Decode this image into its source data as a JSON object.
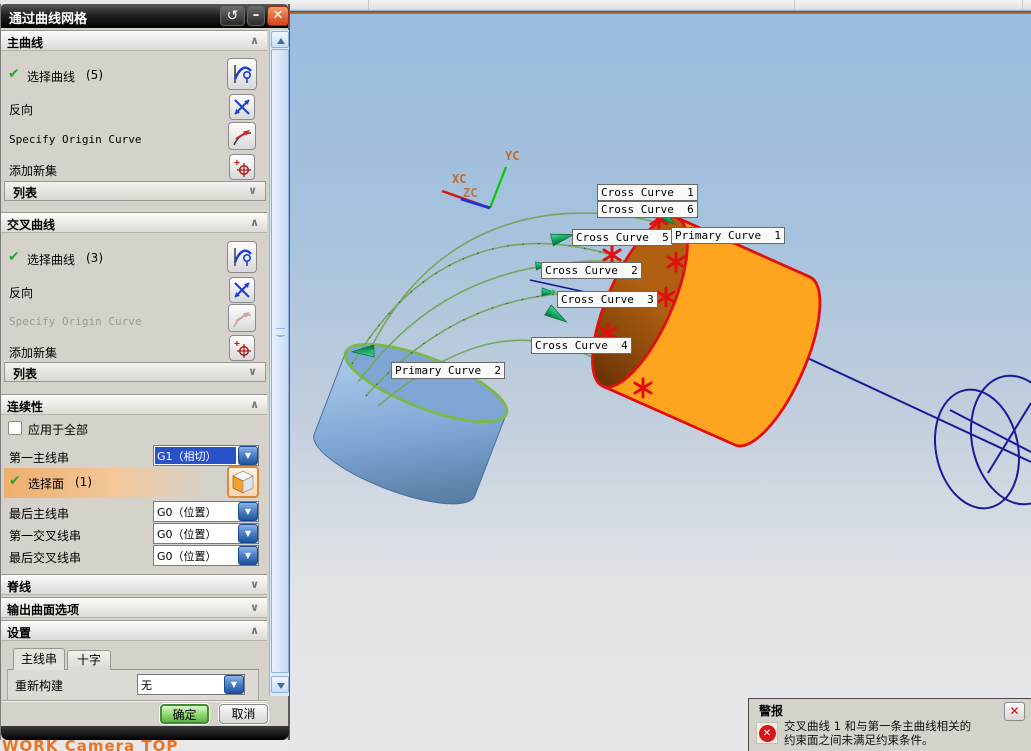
{
  "icons": {
    "check": "✔",
    "collapse": "∧",
    "expand": "∨",
    "dropdown": "▼",
    "reset": "↺",
    "minimize": "–",
    "close": "✕",
    "alert_error": "✕"
  },
  "dialog": {
    "title": "通过曲线网格",
    "primary": {
      "header": "主曲线",
      "select": "选择曲线",
      "count": "(5)",
      "reverse": "反向",
      "origin": "Specify Origin Curve",
      "add_set": "添加新集",
      "list": "列表"
    },
    "cross": {
      "header": "交叉曲线",
      "select": "选择曲线",
      "count": "(3)",
      "reverse": "反向",
      "origin": "Specify Origin Curve",
      "add_set": "添加新集",
      "list": "列表"
    },
    "continuity": {
      "header": "连续性",
      "apply_all": "应用于全部",
      "first_primary": "第一主线串",
      "first_primary_value": "G1（相切）",
      "select_face": "选择面",
      "face_count": "(1)",
      "last_primary": "最后主线串",
      "last_primary_value": "G0（位置）",
      "first_cross": "第一交叉线串",
      "first_cross_value": "G0（位置）",
      "last_cross": "最后交叉线串",
      "last_cross_value": "G0（位置）"
    },
    "spine_header": "脊线",
    "output_header": "输出曲面选项",
    "settings": {
      "header": "设置",
      "tab_primary": "主线串",
      "tab_cross": "十字",
      "rebuild": "重新构建",
      "rebuild_value": "无"
    },
    "ok": "确定",
    "cancel": "取消"
  },
  "viewport": {
    "axis": {
      "xc": "XC",
      "yc": "YC",
      "zc": "ZC"
    },
    "labels": {
      "cross1": "Cross Curve  1",
      "cross6": "Cross Curve  6",
      "cross5": "Cross Curve  5",
      "primary1": "Primary Curve  1",
      "cross2": "Cross Curve  2",
      "cross3": "Cross Curve  3",
      "cross4": "Cross Curve  4",
      "primary2": "Primary Curve  2"
    },
    "status_text": "WORK Camera TOP",
    "colors": {
      "curve_green": "#74a85c",
      "highlight_red": "#e01010",
      "cylinder_blue": "#7ea6d4",
      "cylinder_orange": "#ff8a00",
      "wireframe_blue": "#1a1a99",
      "background_top": "#9abcdd",
      "background_bottom": "#e7e7e9"
    }
  },
  "alert": {
    "title": "警报",
    "line1": "交叉曲线 1 和与第一条主曲线相关的",
    "line2": "约束面之间未满足约束条件。"
  }
}
